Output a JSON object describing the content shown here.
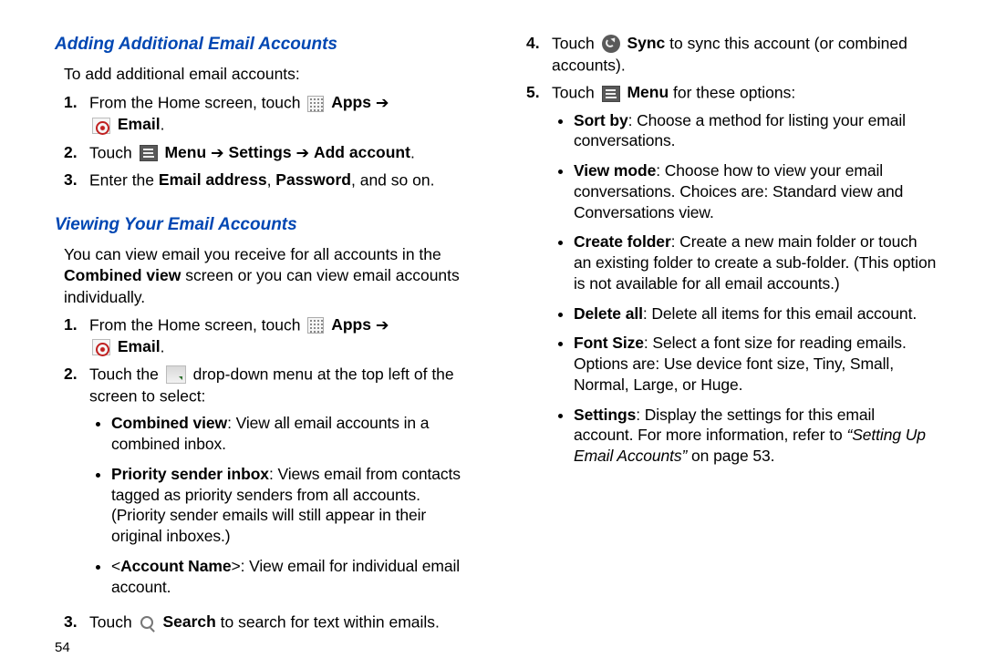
{
  "left": {
    "sec1": {
      "title": "Adding Additional Email Accounts",
      "intro": "To add additional email accounts:",
      "steps": [
        {
          "num": "1.",
          "a": "From the Home screen, touch ",
          "apps": "Apps",
          "arr": " ➔",
          "email": "Email",
          "dot": "."
        },
        {
          "num": "2.",
          "a": "Touch ",
          "menu": "Menu",
          "arr1": " ➔ ",
          "settings": "Settings",
          "arr2": " ➔ ",
          "addacct": "Add account",
          "dot": "."
        },
        {
          "num": "3.",
          "a": "Enter the ",
          "emladdr": "Email address",
          "comma": ", ",
          "pwd": "Password",
          "rest": ", and so on."
        }
      ]
    },
    "sec2": {
      "title": "Viewing Your Email Accounts",
      "para_a": "You can view email you receive for all accounts in the ",
      "para_b": "Combined view",
      "para_c": " screen or you can view email accounts individually.",
      "s1": {
        "num": "1.",
        "a": "From the Home screen, touch ",
        "apps": "Apps",
        "arr": " ➔",
        "email": "Email",
        "dot": "."
      },
      "s2": {
        "num": "2.",
        "a": "Touch the ",
        "b": " drop-down menu at the top left of the screen to select:"
      },
      "bullets": [
        {
          "bold": "Combined view",
          "rest": ": View all email accounts in a combined inbox."
        },
        {
          "bold": "Priority sender inbox",
          "rest": ": Views email from contacts tagged as priority senders from all accounts. (Priority sender emails will still appear in their original inboxes.)"
        },
        {
          "pre": "<",
          "bold": "Account Name",
          "rest": ">: View email for individual email account."
        }
      ],
      "s3": {
        "num": "3.",
        "a": "Touch ",
        "search": "Search",
        "rest": " to search for text within emails."
      }
    },
    "pagenum": "54"
  },
  "right": {
    "s4": {
      "num": "4.",
      "a": "Touch ",
      "sync": "Sync",
      "rest": " to sync this account (or combined accounts)."
    },
    "s5": {
      "num": "5.",
      "a": "Touch ",
      "menu": "Menu",
      "rest": " for these options:"
    },
    "bullets": [
      {
        "bold": "Sort by",
        "rest": ": Choose a method for listing your email conversations."
      },
      {
        "bold": "View mode",
        "rest": ": Choose how to view your email conversations. Choices are: Standard view and Conversations view."
      },
      {
        "bold": "Create folder",
        "rest": ": Create a new main folder or touch an existing folder to create a sub-folder. (This option is not available for all email accounts.)"
      },
      {
        "bold": "Delete all",
        "rest": ": Delete all items for this email account."
      },
      {
        "bold": "Font Size",
        "rest": ": Select a font size for reading emails. Options are: Use device font size, Tiny, Small, Normal, Large, or Huge."
      },
      {
        "bold": "Settings",
        "rest": ": Display the settings for this email account. For more information, refer to ",
        "ital": "“Setting Up Email Accounts” ",
        "tail": " on page 53."
      }
    ]
  }
}
